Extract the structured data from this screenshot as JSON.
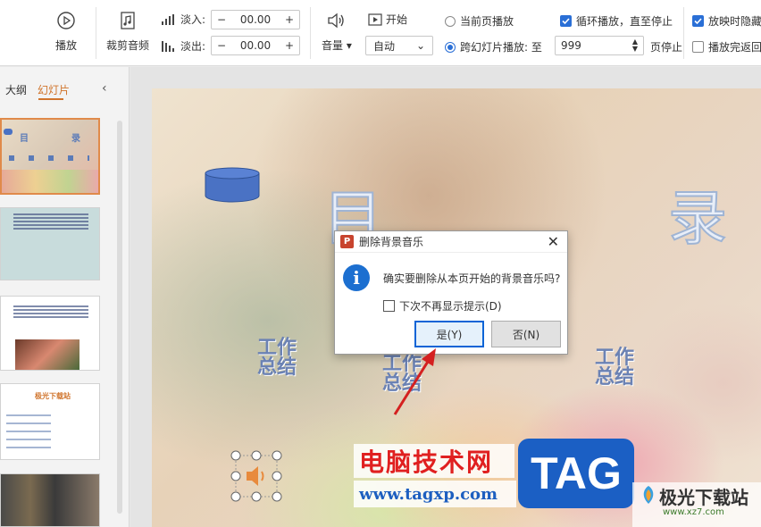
{
  "ribbon": {
    "play": "播放",
    "trim_audio": "裁剪音频",
    "fade_in_label": "淡入:",
    "fade_in_value": "00.00",
    "fade_out_label": "淡出:",
    "fade_out_value": "00.00",
    "minus": "−",
    "plus": "+",
    "volume": "音量",
    "start_label": "开始",
    "start_value": "自动",
    "play_current_page": "当前页播放",
    "play_across_slides": "跨幻灯片播放: 至",
    "slide_count_value": "999",
    "stop_after_page": "页停止",
    "loop_until_stop": "循环播放，直至停止",
    "hide_when_showing": "放映时隐藏",
    "rewind_after_play": "播放完返回"
  },
  "panel": {
    "tab_outline": "大纲",
    "tab_slides": "幻灯片",
    "collapse_icon": "‹",
    "thumb1": {
      "chars": [
        "目",
        "录"
      ]
    },
    "thumb4": {
      "title": "极光下载站"
    }
  },
  "slide": {
    "char_mu": "目",
    "char_lu": "录",
    "items": [
      "工作\n总结",
      "工作\n总结",
      "工作\n总结"
    ]
  },
  "dialog": {
    "title": "删除背景音乐",
    "close_icon": "✕",
    "message": "确实要删除从本页开始的背景音乐吗?",
    "checkbox_label": "下次不再显示提示(D)",
    "yes": "是(Y)",
    "no": "否(N)"
  },
  "watermarks": {
    "site_cn": "电脑技术网",
    "site_url": "www.tagxp.com",
    "tag": "TAG",
    "jg_name": "极光下载站",
    "jg_url": "www.xz7.com"
  },
  "colors": {
    "accent": "#d0742c",
    "dialog_blue": "#1c6fd0",
    "slide_text": "#6b82b4"
  }
}
